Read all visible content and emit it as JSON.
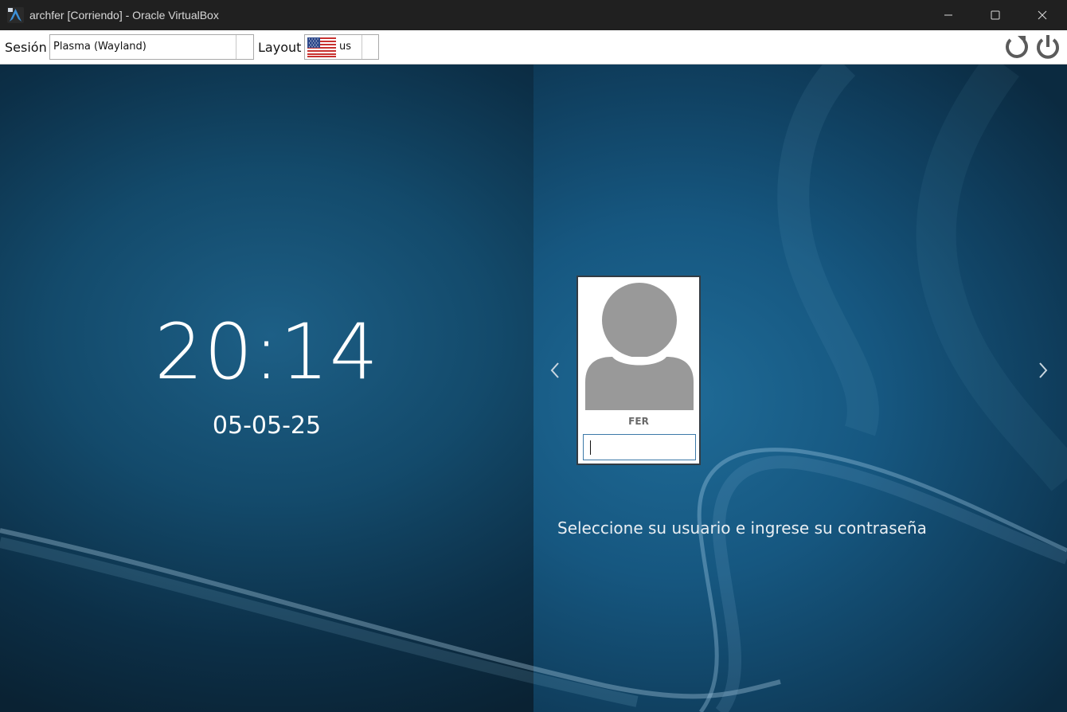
{
  "window": {
    "title": "archfer [Corriendo] - Oracle VirtualBox",
    "app_icon": "virtualbox-arch-icon",
    "controls": [
      "minimize-icon",
      "maximize-icon",
      "close-icon"
    ]
  },
  "toolbar": {
    "session_label": "Sesión",
    "session_value": "Plasma (Wayland)",
    "layout_label": "Layout",
    "layout_value": "us",
    "layout_flag": "us-flag-icon",
    "reboot_icon": "reboot-icon",
    "shutdown_icon": "power-icon"
  },
  "greeter": {
    "time": "20:14",
    "date": "05-05-25",
    "user": {
      "name": "FER",
      "avatar_icon": "user-avatar-icon",
      "password_value": ""
    },
    "prev_icon": "chevron-left-icon",
    "next_icon": "chevron-right-icon",
    "prompt": "Seleccione su usuario e ingrese su contraseña"
  },
  "colors": {
    "titlebar_bg": "#202020",
    "toolbar_bg": "#ffffff",
    "background_dark": "#0a2233",
    "background_accent": "#1f6b97",
    "input_border": "#3c79a8",
    "avatar_gray": "#999999"
  }
}
